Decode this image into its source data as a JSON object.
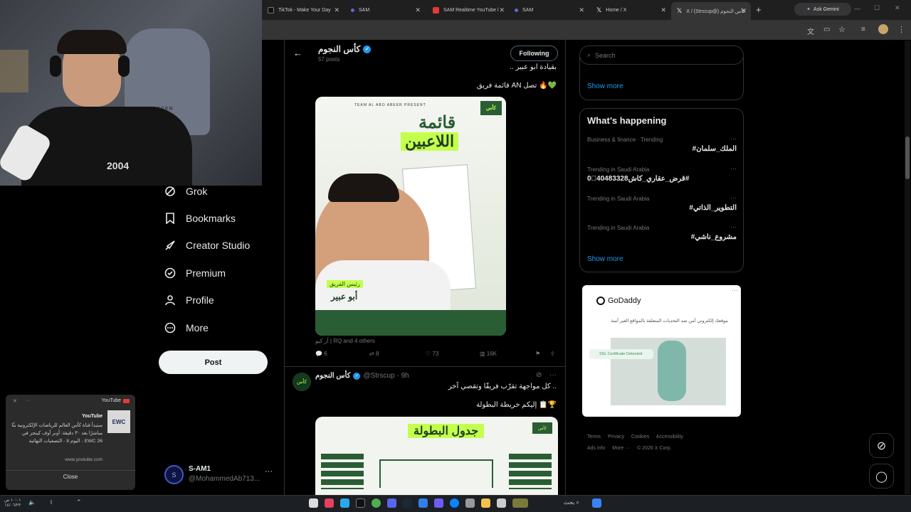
{
  "browser": {
    "tabs": [
      {
        "label": "TikTok - Make Your Day",
        "color": "#111111"
      },
      {
        "label": "SAM",
        "color": "#5b6bd6"
      },
      {
        "label": "SAM Realtime YouTube l",
        "color": "#e53935"
      },
      {
        "label": "SAM",
        "color": "#5b6bd6"
      },
      {
        "label": "Home / X",
        "color": "#000000"
      },
      {
        "label": "X / (Strscup@) كأس النجوم",
        "color": "#000000"
      }
    ],
    "gemini_label": "Ask Gemini"
  },
  "sidebar": {
    "items": [
      {
        "label": "Grok",
        "icon": "grok-icon"
      },
      {
        "label": "Bookmarks",
        "icon": "bookmark-icon"
      },
      {
        "label": "Creator Studio",
        "icon": "rocket-icon"
      },
      {
        "label": "Premium",
        "icon": "verified-icon"
      },
      {
        "label": "Profile",
        "icon": "person-icon"
      },
      {
        "label": "More",
        "icon": "more-circle-icon"
      }
    ],
    "post_label": "Post",
    "account": {
      "name": "S-AM1",
      "handle": "@MohammedAb713..."
    }
  },
  "profile_header": {
    "name": "كأس النجوم",
    "posts": "57 posts",
    "follow_label": "Following"
  },
  "tweet1": {
    "line1": "بقيادة ابو عبير ..",
    "line2": "قائمة فريق AN تصل 🔥💚",
    "image_title1": "قائمة",
    "image_title2": "اللاعبين",
    "image_top": "TEAM AL ABO ABEER PRESENT",
    "captain_label": "رئيس الفريق",
    "captain_name": "أبو عبير",
    "tag_line": "آر كيو | RQ and 4 others",
    "replies": "6",
    "reposts": "8",
    "likes": "73",
    "views": "16K"
  },
  "tweet2": {
    "name": "كأس النجوم",
    "handle": "@Strscup",
    "time": "· 9h",
    "line1": "كل مواجهة تقرّب فريقًا وتقصي آخر ..",
    "line2": "إليكم خريطة البطولة 📋🏆",
    "image_title": "جدول البطولة"
  },
  "right": {
    "search_placeholder": "Search",
    "show_more": "Show more",
    "whats_happening": "What’s happening",
    "trends": [
      {
        "meta": "Business & finance · Trending",
        "title": "#الملك_سلمان"
      },
      {
        "meta": "Trending in Saudi Arabia",
        "title": "قرض_عقاري_كاش0⃣40483328#"
      },
      {
        "meta": "Trending in Saudi Arabia",
        "title": "#التطوير_الذاتي"
      },
      {
        "meta": "Trending in Saudi Arabia",
        "title": "#مشروع_ناشي"
      }
    ],
    "show_more2": "Show more",
    "ad": {
      "brand": "GoDaddy",
      "text": "موقعك إلكتروني آمن ضد التحديات المتعلقة بالمواقع الغير آمنة",
      "badge": "SSL Certificate Detected"
    },
    "footer": [
      "Terms",
      "Privacy",
      "Cookies",
      "Accessibility",
      "Ads info",
      "More ···",
      "© 2026 X Corp."
    ]
  },
  "toast": {
    "header": "YouTube",
    "app": "YouTube",
    "body": "ستبدأ قناة كأس العالم للرياضات الإلكترونية بثًا مباشرًا بعد ٣٠ دقيقة: أونر أوف كينجز في EWC 26 - اليوم 8 - التصفيات النهائية",
    "link": "www.youtube.com",
    "close": "Close",
    "logo_text": "EWC"
  },
  "taskbar": {
    "search": "بحث",
    "time": "١٠:٠١ ص",
    "date": "١٤/٠٦/٢٣"
  }
}
